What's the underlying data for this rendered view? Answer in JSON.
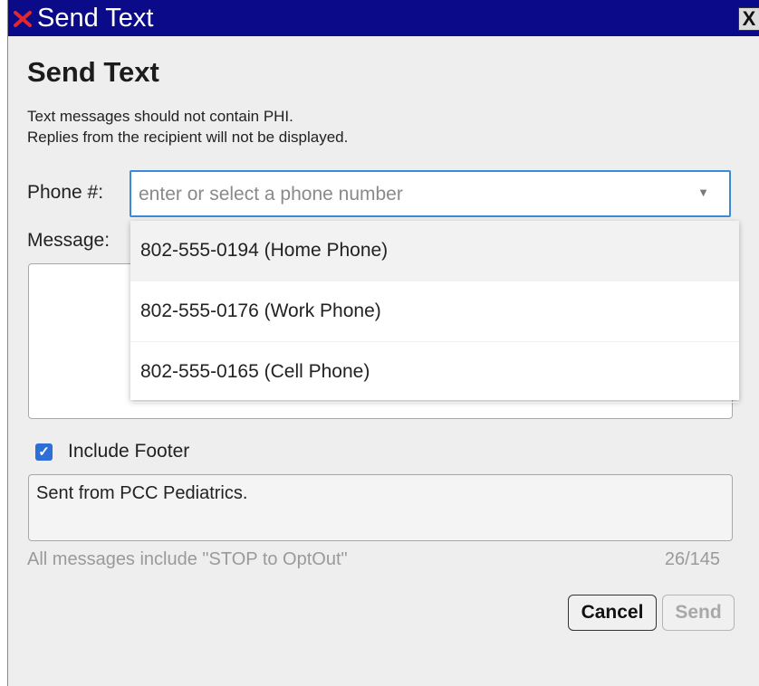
{
  "window": {
    "title": "Send Text",
    "close_label": "X",
    "logo_icon": "red-x-logo-icon",
    "titlebar_color": "#0b0b8a"
  },
  "dialog": {
    "heading": "Send Text",
    "notes": [
      "Text messages should not contain PHI.",
      "Replies from the recipient will not be displayed."
    ]
  },
  "phone": {
    "label": "Phone #:",
    "placeholder": "enter or select a phone number",
    "options": [
      "802-555-0194 (Home Phone)",
      "802-555-0176 (Work Phone)",
      "802-555-0165 (Cell Phone)"
    ]
  },
  "message": {
    "label": "Message:",
    "value": ""
  },
  "footer": {
    "checkbox_label": "Include Footer",
    "checked": true,
    "text": "Sent from PCC Pediatrics.",
    "optout_note": "All messages include \"STOP to OptOut\"",
    "counter": "26/145"
  },
  "buttons": {
    "cancel": "Cancel",
    "send": "Send"
  },
  "colors": {
    "accent": "#3b8ad8",
    "checkbox": "#2d6fd6"
  }
}
